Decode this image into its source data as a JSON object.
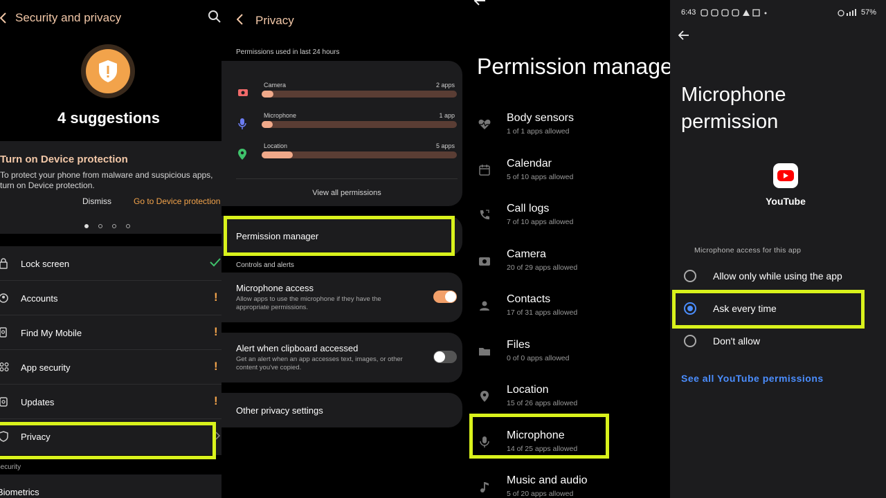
{
  "security_screen": {
    "title": "Security and privacy",
    "suggestions": "4 suggestions",
    "card": {
      "title": "Turn on Device protection",
      "description": "To protect your phone from malware and suspicious apps, turn on Device protection.",
      "dismiss": "Dismiss",
      "action": "Go to Device protection"
    },
    "items": [
      {
        "label": "Lock screen",
        "status": "check",
        "icon": "lock-icon"
      },
      {
        "label": "Accounts",
        "status": "warning",
        "icon": "account-icon"
      },
      {
        "label": "Find My Mobile",
        "status": "warning",
        "icon": "find-mobile-icon"
      },
      {
        "label": "App security",
        "status": "warning",
        "icon": "app-security-icon"
      },
      {
        "label": "Updates",
        "status": "warning",
        "icon": "updates-icon"
      },
      {
        "label": "Privacy",
        "status": "none",
        "icon": "privacy-icon"
      }
    ],
    "warning_glyph": "!",
    "section_security": "Security",
    "biometrics": "Biometrics"
  },
  "privacy_screen": {
    "title": "Privacy",
    "usage_header": "Permissions used in last 24 hours",
    "usage": [
      {
        "label": "Camera",
        "count": "2 apps",
        "fraction": 0.06,
        "color": "#f06a6a",
        "icon": "camera-icon"
      },
      {
        "label": "Microphone",
        "count": "1 app",
        "fraction": 0.03,
        "color": "#6b7cf0",
        "icon": "microphone-icon"
      },
      {
        "label": "Location",
        "count": "5 apps",
        "fraction": 0.16,
        "color": "#3fc26b",
        "icon": "location-icon"
      }
    ],
    "view_all": "View all permissions",
    "permission_manager": "Permission manager",
    "controls_header": "Controls and alerts",
    "mic_access": {
      "title": "Microphone access",
      "desc": "Allow apps to use the microphone if they have the appropriate permissions.",
      "on": true
    },
    "clipboard": {
      "title": "Alert when clipboard accessed",
      "desc": "Get an alert when an app accesses text, images, or other content you've copied.",
      "on": false
    },
    "other": "Other privacy settings"
  },
  "permission_manager_screen": {
    "title": "Permission manager",
    "items": [
      {
        "title": "Body sensors",
        "sub": "1 of 1 apps allowed",
        "icon": "heart-icon"
      },
      {
        "title": "Calendar",
        "sub": "5 of 10 apps allowed",
        "icon": "calendar-icon"
      },
      {
        "title": "Call logs",
        "sub": "7 of 10 apps allowed",
        "icon": "call-log-icon"
      },
      {
        "title": "Camera",
        "sub": "20 of 29 apps allowed",
        "icon": "camera-icon"
      },
      {
        "title": "Contacts",
        "sub": "17 of 31 apps allowed",
        "icon": "contacts-icon"
      },
      {
        "title": "Files",
        "sub": "0 of 0 apps allowed",
        "icon": "folder-icon"
      },
      {
        "title": "Location",
        "sub": "15 of 26 apps allowed",
        "icon": "location-icon"
      },
      {
        "title": "Microphone",
        "sub": "14 of 25 apps allowed",
        "icon": "microphone-icon"
      },
      {
        "title": "Music and audio",
        "sub": "5 of 20 apps allowed",
        "icon": "music-icon"
      }
    ]
  },
  "mic_permission_screen": {
    "status_time": "6:43",
    "battery": "57%",
    "title": "Microphone permission",
    "app_name": "YouTube",
    "access_header": "Microphone access for this app",
    "options": [
      {
        "label": "Allow only while using the app",
        "selected": false
      },
      {
        "label": "Ask every time",
        "selected": true
      },
      {
        "label": "Don't allow",
        "selected": false
      }
    ],
    "see_all": "See all YouTube permissions"
  },
  "colors": {
    "highlight": "#d9f21c",
    "accent_orange": "#f2a34b",
    "link_blue": "#4b8eff",
    "toggle_on": "#f2a06a"
  }
}
